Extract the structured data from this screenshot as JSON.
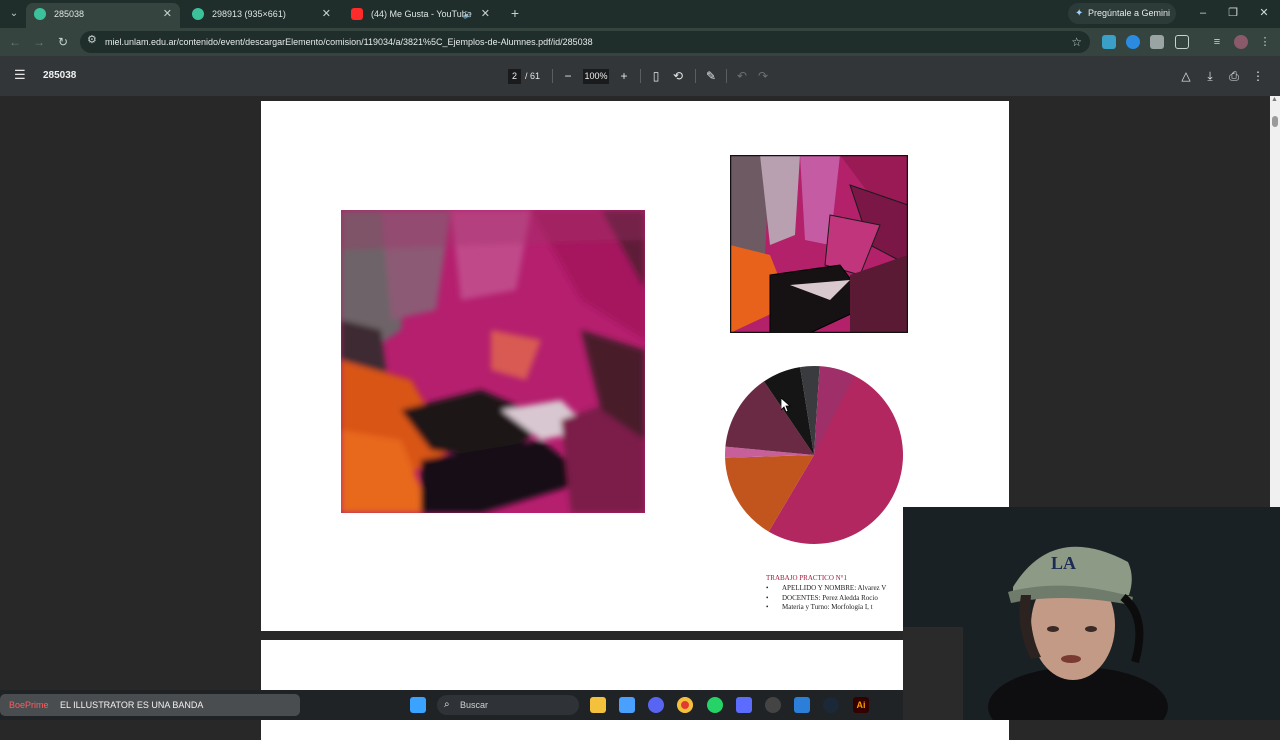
{
  "browser": {
    "tabs": [
      {
        "title": "285038",
        "active": true,
        "favicon_color": "#3cc29a"
      },
      {
        "title": "298913 (935×661)",
        "active": false,
        "favicon_color": "#3cc29a"
      },
      {
        "title": "(44) Me Gusta - YouTube",
        "active": false,
        "favicon_color": "#ff2a2a"
      }
    ],
    "gemini_label": "Pregúntale a Gemini",
    "url": "miel.unlam.edu.ar/contenido/event/descargarElemento/comision/119034/a/3821%5C_Ejemplos-de-Alumnes.pdf/id/285038"
  },
  "pdf": {
    "title": "285038",
    "current_page": "2",
    "total_pages": "/ 61",
    "zoom": "100%"
  },
  "document": {
    "caption_title": "TRABAJO PRACTICO N°1",
    "caption_items": [
      "APELLIDO Y NOMBRE: Alvarez V",
      "DOCENTES: Perez Aledda Rocio",
      "Materia y Turno: Morfología I, t"
    ],
    "pie_slices": [
      {
        "color": "#b2275f",
        "fraction": 0.55
      },
      {
        "color": "#c2541d",
        "fraction": 0.16
      },
      {
        "color": "#c7609a",
        "fraction": 0.02
      },
      {
        "color": "#6a2a44",
        "fraction": 0.14
      },
      {
        "color": "#151515",
        "fraction": 0.07
      },
      {
        "color": "#3a3b3f",
        "fraction": 0.035
      },
      {
        "color": "#9e2f68",
        "fraction": 0.065
      }
    ]
  },
  "taskbar": {
    "chat_user": "BoePrime",
    "chat_message": "EL ILLUSTRATOR ES UNA BANDA",
    "search_placeholder": "Buscar"
  }
}
